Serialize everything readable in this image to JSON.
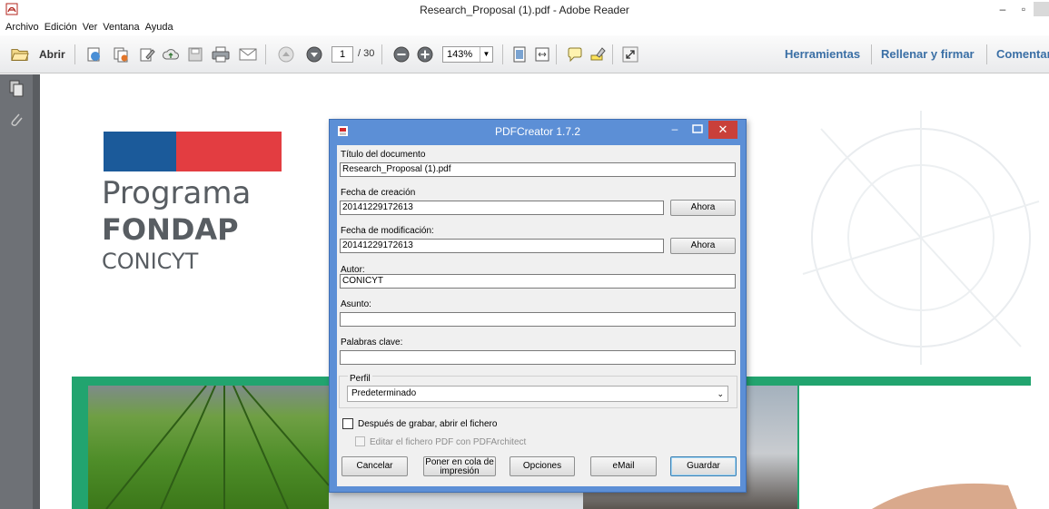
{
  "window": {
    "title": "Research_Proposal (1).pdf - Adobe Reader",
    "minimize": "–",
    "restore": "▫"
  },
  "menu": [
    "Archivo",
    "Edición",
    "Ver",
    "Ventana",
    "Ayuda"
  ],
  "toolbar": {
    "open_label": "Abrir",
    "page_current": "1",
    "page_total": "/ 30",
    "zoom": "143%",
    "links": [
      "Herramientas",
      "Rellenar y firmar",
      "Comentar"
    ]
  },
  "document": {
    "logo_line1": "Programa",
    "logo_line2": "FONDAP",
    "logo_line3": "CONICYT",
    "colors": {
      "flag_blue": "#1b5a9a",
      "flag_red": "#e33d41",
      "band_green": "#22a46f"
    }
  },
  "dialog": {
    "title": "PDFCreator 1.7.2",
    "close": "✕",
    "minimize": "–",
    "fields": {
      "doc_title_label": "Título del documento",
      "doc_title_value": "Research_Proposal (1).pdf",
      "created_label": "Fecha de creación",
      "created_value": "20141229172613",
      "modified_label": "Fecha de modificación:",
      "modified_value": "20141229172613",
      "author_label": "Autor:",
      "author_value": "CONICYT",
      "subject_label": "Asunto:",
      "subject_value": "",
      "keywords_label": "Palabras clave:",
      "keywords_value": ""
    },
    "now_button": "Ahora",
    "profile_group": "Perfil",
    "profile_value": "Predeterminado",
    "open_after_save": "Después de grabar, abrir el fichero",
    "edit_with_architect": "Editar el fichero PDF con PDFArchitect",
    "buttons": {
      "cancel": "Cancelar",
      "queue_line1": "Poner en cola de",
      "queue_line2": "impresión",
      "options": "Opciones",
      "email": "eMail",
      "save": "Guardar"
    }
  }
}
